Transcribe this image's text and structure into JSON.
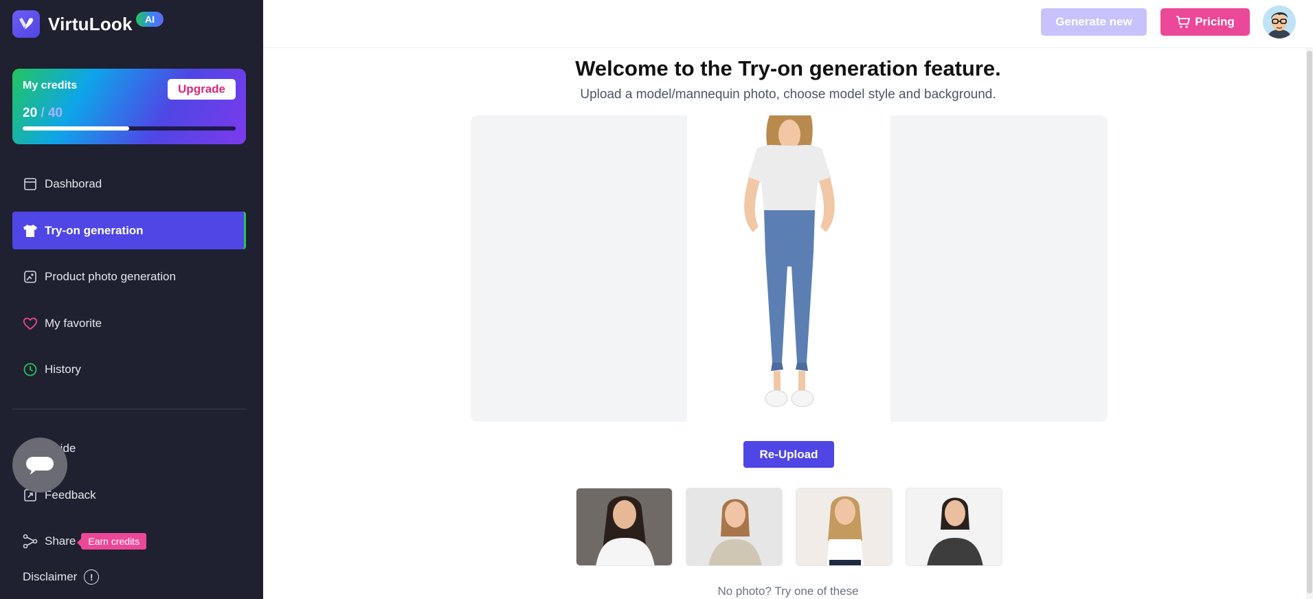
{
  "brand": {
    "name": "VirtuLook",
    "badge": "AI"
  },
  "credits": {
    "title": "My credits",
    "used": "20",
    "separator": "/",
    "total": "40",
    "progress": 0.5,
    "upgrade_label": "Upgrade"
  },
  "nav": {
    "items": [
      {
        "label": "Dashborad",
        "icon": "dashboard-icon",
        "active": false
      },
      {
        "label": "Try-on generation",
        "icon": "tshirt-icon",
        "active": true
      },
      {
        "label": "Product photo generation",
        "icon": "photo-edit-icon",
        "active": false
      },
      {
        "label": "My favorite",
        "icon": "heart-icon",
        "active": false
      },
      {
        "label": "History",
        "icon": "clock-icon",
        "active": false
      }
    ],
    "secondary": [
      {
        "label": "Guide",
        "icon": "book-icon"
      },
      {
        "label": "Feedback",
        "icon": "external-link-icon"
      },
      {
        "label": "Share",
        "icon": "share-icon",
        "badge": "Earn credits"
      }
    ],
    "disclaimer": "Disclaimer"
  },
  "topbar": {
    "generate_label": "Generate new",
    "pricing_label": "Pricing"
  },
  "main": {
    "title": "Welcome to the Try-on generation feature.",
    "subtitle": "Upload a model/mannequin photo, choose model style and background.",
    "reupload_label": "Re-Upload",
    "hint": "No photo? Try one of these"
  },
  "colors": {
    "accent": "#4f46e5",
    "pink": "#ec4899",
    "sidebar": "#1f2030"
  }
}
